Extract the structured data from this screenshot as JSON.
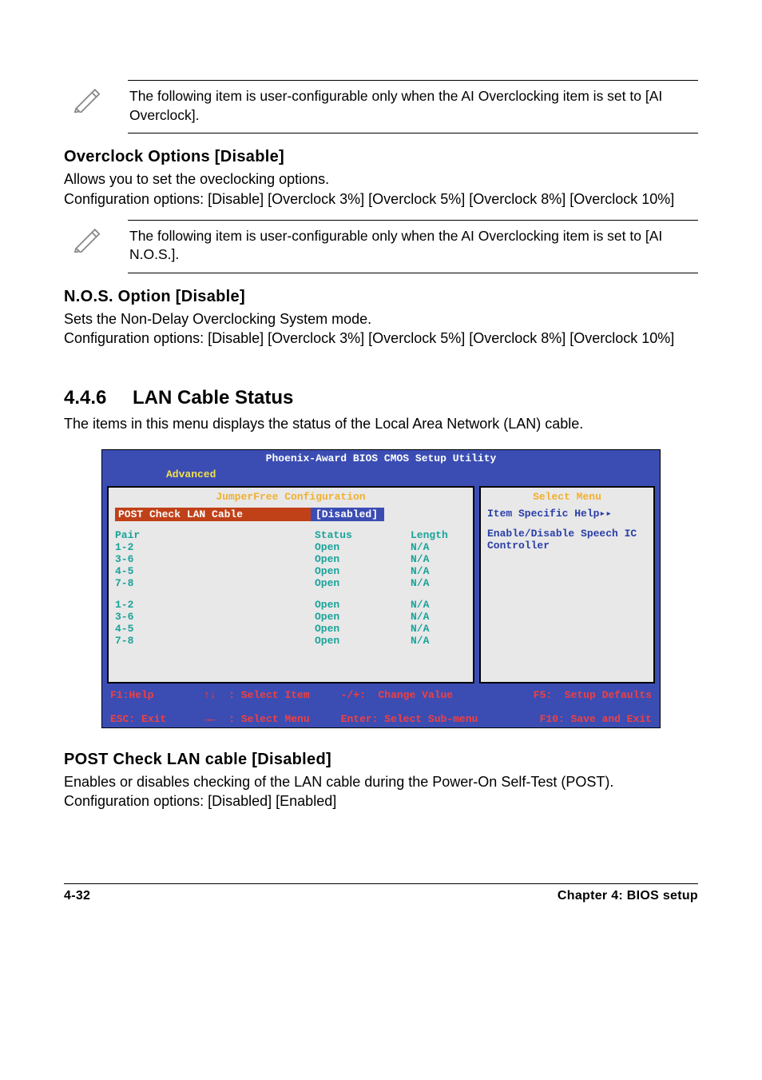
{
  "note1": "The following item is user-configurable only when the AI Overclocking item is set to [AI Overclock].",
  "overclock": {
    "heading": "Overclock Options [Disable]",
    "body": "Allows you to set the oveclocking options.\nConfiguration options: [Disable] [Overclock 3%] [Overclock 5%] [Overclock 8%] [Overclock 10%]"
  },
  "note2": "The following item is user-configurable only when the AI Overclocking item is set to [AI N.O.S.].",
  "nos": {
    "heading": "N.O.S. Option [Disable]",
    "body": "Sets the Non-Delay Overclocking System mode.\nConfiguration options: [Disable] [Overclock 3%] [Overclock 5%] [Overclock 8%] [Overclock 10%]"
  },
  "section": {
    "num": "4.4.6",
    "title": "LAN Cable Status",
    "intro": "The items in this menu displays the status of the Local Area Network (LAN) cable."
  },
  "bios": {
    "toptitle": "Phoenix-Award BIOS CMOS Setup Utility",
    "tab": "Advanced",
    "left_title": "JumperFree Configuration",
    "right_title": "Select Menu",
    "highlight_label": "POST Check LAN Cable",
    "highlight_value": "[Disabled]",
    "help_header": "Item Specific Help▸▸",
    "help_text": "Enable/Disable Speech IC Controller",
    "header_row": {
      "c1": "Pair",
      "c2": "Status",
      "c3": "Length"
    },
    "rows_a": [
      {
        "c1": "1-2",
        "c2": "Open",
        "c3": "N/A"
      },
      {
        "c1": "3-6",
        "c2": "Open",
        "c3": "N/A"
      },
      {
        "c1": "4-5",
        "c2": "Open",
        "c3": "N/A"
      },
      {
        "c1": "7-8",
        "c2": "Open",
        "c3": "N/A"
      }
    ],
    "rows_b": [
      {
        "c1": "1-2",
        "c2": "Open",
        "c3": "N/A"
      },
      {
        "c1": "3-6",
        "c2": "Open",
        "c3": "N/A"
      },
      {
        "c1": "4-5",
        "c2": "Open",
        "c3": "N/A"
      },
      {
        "c1": "7-8",
        "c2": "Open",
        "c3": "N/A"
      }
    ],
    "foot": {
      "l1a": "F1:Help",
      "l1b": "↑↓  : Select Item",
      "l1c": "-/+:  Change Value",
      "l1d": "F5:  Setup Defaults",
      "l2a": "ESC: Exit",
      "l2b": "→←  : Select Menu",
      "l2c": "Enter: Select Sub-menu",
      "l2d": "F10: Save and Exit"
    }
  },
  "postcheck": {
    "heading": "POST Check LAN cable [Disabled]",
    "body": "Enables or disables checking of the LAN cable during the Power-On Self-Test (POST). Configuration options: [Disabled] [Enabled]"
  },
  "footer": {
    "left": "4-32",
    "right": "Chapter 4: BIOS setup"
  }
}
